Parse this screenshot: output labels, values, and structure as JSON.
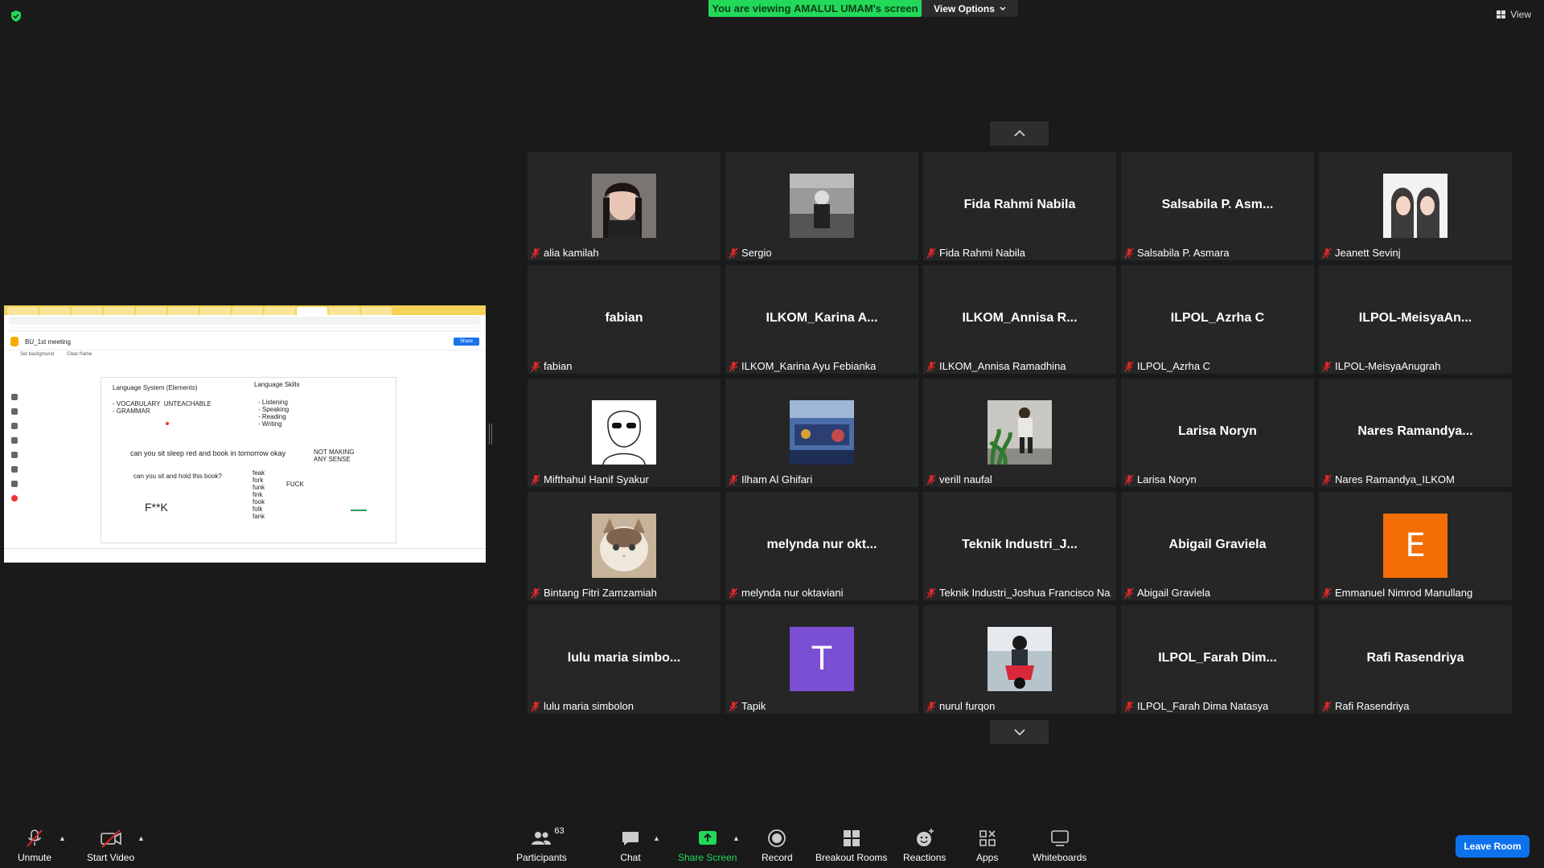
{
  "banner": {
    "viewing_prefix": "You are viewing ",
    "viewing_name": "AMALUL UMAM's screen",
    "view_options": "View Options",
    "view_top": "View"
  },
  "shared_screen": {
    "board_title": "BU_1st meeting",
    "share_label": "Share",
    "set_background": "Set background",
    "clear_frame": "Clear frame",
    "lines": {
      "language_system": "Language System (Elements)",
      "language_skills": "Language Skills",
      "vocab": "- VOCABULARY  UNTEACHABLE\n- GRAMMAR",
      "skills": "- Listening\n- Speaking\n- Reading\n- Writing",
      "sentence1": "can you sit sleep red and book in tomorrow okay",
      "not_making": "NOT MAKING\nANY SENSE",
      "sentence2": "can you sit and hold this book?",
      "variants": "feak\nfork\nfunk\nfink\nfook\nfolk\nfank",
      "fuck": "FUCK",
      "censored": "F**K"
    }
  },
  "participants": [
    {
      "center": "",
      "name": "alia kamilah",
      "pic": "photo-girl"
    },
    {
      "center": "",
      "name": "Sergio",
      "pic": "photo-bw"
    },
    {
      "center": "Fida Rahmi Nabila",
      "name": "Fida Rahmi Nabila",
      "pic": ""
    },
    {
      "center": "Salsabila P. Asm...",
      "name": "Salsabila P. Asmara",
      "pic": ""
    },
    {
      "center": "",
      "name": "Jeanett Sevinj",
      "pic": "photo-two"
    },
    {
      "center": "fabian",
      "name": "fabian",
      "pic": ""
    },
    {
      "center": "ILKOM_Karina  A...",
      "name": "ILKOM_Karina Ayu Febianka",
      "pic": ""
    },
    {
      "center": "ILKOM_Annisa  R...",
      "name": "ILKOM_Annisa Ramadhina",
      "pic": ""
    },
    {
      "center": "ILPOL_Azrha C",
      "name": "ILPOL_Azrha C",
      "pic": ""
    },
    {
      "center": "ILPOL-MeisyaAn...",
      "name": "ILPOL-MeisyaAnugrah",
      "pic": ""
    },
    {
      "center": "",
      "name": "Mifthahul Hanif Syakur",
      "pic": "photo-sketch"
    },
    {
      "center": "",
      "name": "Ilham Al Ghifari",
      "pic": "photo-blue"
    },
    {
      "center": "",
      "name": "verill naufal",
      "pic": "photo-plant"
    },
    {
      "center": "Larisa Noryn",
      "name": "Larisa Noryn",
      "pic": ""
    },
    {
      "center": "Nares  Ramandya...",
      "name": "Nares Ramandya_ILKOM",
      "pic": ""
    },
    {
      "center": "",
      "name": "Bintang Fitri Zamzamiah",
      "pic": "photo-cat"
    },
    {
      "center": "melynda  nur  okt...",
      "name": "melynda nur oktaviani",
      "pic": ""
    },
    {
      "center": "Teknik  Industri_J...",
      "name": "Teknik Industri_Joshua Francisco Na...",
      "pic": ""
    },
    {
      "center": "Abigail Graviela",
      "name": "Abigail Graviela",
      "pic": ""
    },
    {
      "center": "",
      "name": "Emmanuel Nimrod Manullang",
      "pic": "letter",
      "letter": "E",
      "letter_color": "#f26d06"
    },
    {
      "center": "lulu  maria  simbo...",
      "name": "lulu maria simbolon",
      "pic": ""
    },
    {
      "center": "",
      "name": "Tapik",
      "pic": "letter",
      "letter": "T",
      "letter_color": "#7b4fd3"
    },
    {
      "center": "",
      "name": "nurul furqon",
      "pic": "photo-moto"
    },
    {
      "center": "ILPOL_Farah  Dim...",
      "name": "ILPOL_Farah Dima Natasya",
      "pic": ""
    },
    {
      "center": "Rafi Rasendriya",
      "name": "Rafi Rasendriya",
      "pic": ""
    }
  ],
  "toolbar": {
    "unmute": "Unmute",
    "start_video": "Start Video",
    "participants": "Participants",
    "participants_count": "63",
    "chat": "Chat",
    "share_screen": "Share Screen",
    "record": "Record",
    "breakout_rooms": "Breakout Rooms",
    "reactions": "Reactions",
    "apps": "Apps",
    "whiteboards": "Whiteboards",
    "leave_room": "Leave Room"
  },
  "colors": {
    "banner_green": "#23d959",
    "leave_blue": "#0e72ed",
    "tile_bg": "#262626",
    "mic_red": "#e02828"
  }
}
